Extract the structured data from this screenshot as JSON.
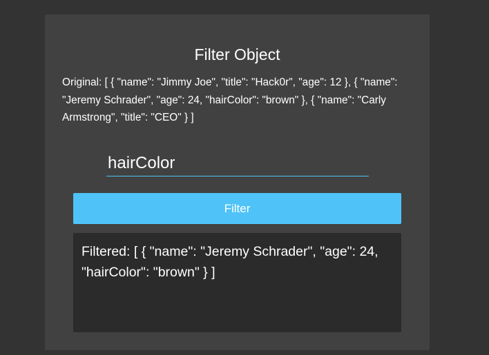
{
  "panel": {
    "title": "Filter Object",
    "original_text": "Original: [ { \"name\": \"Jimmy Joe\", \"title\": \"Hack0r\", \"age\": 12 }, { \"name\": \"Jeremy Schrader\", \"age\": 24, \"hairColor\": \"brown\" }, { \"name\": \"Carly Armstrong\", \"title\": \"CEO\" } ]",
    "filter_input_value": "hairColor",
    "filter_button_label": "Filter",
    "filtered_text": "Filtered: [ { \"name\": \"Jeremy Schrader\", \"age\": 24, \"hairColor\": \"brown\" } ]"
  },
  "colors": {
    "page_background": "#333333",
    "panel_background": "#414141",
    "accent": "#4fc3f7",
    "result_background": "#2b2b2b",
    "text": "#ffffff"
  }
}
